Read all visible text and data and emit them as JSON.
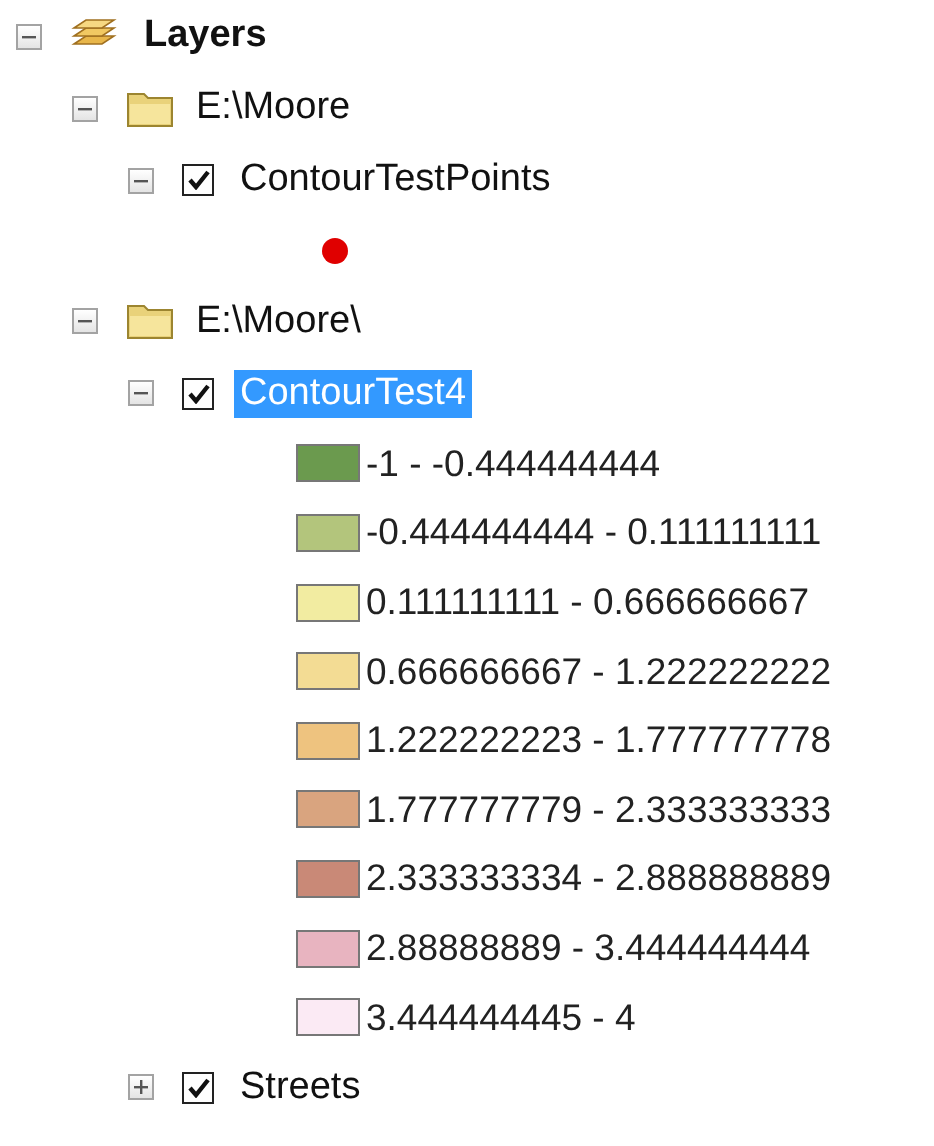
{
  "tree": {
    "label": "Layers",
    "kind": "root",
    "expanded": true,
    "children": [
      {
        "label": "E:\\Moore",
        "kind": "folder",
        "expanded": true,
        "children": [
          {
            "label": "ContourTestPoints",
            "kind": "layer",
            "expanded": true,
            "checked": true,
            "selected": false,
            "legend": [
              {
                "kind": "marker",
                "color": "#e00000"
              }
            ]
          }
        ]
      },
      {
        "label": "E:\\Moore\\",
        "kind": "folder",
        "expanded": true,
        "children": [
          {
            "label": "ContourTest4",
            "kind": "layer",
            "expanded": true,
            "checked": true,
            "selected": true,
            "legend": [
              {
                "kind": "swatch",
                "label": "-1 - -0.444444444",
                "color": "#6b9a4e"
              },
              {
                "kind": "swatch",
                "label": "-0.444444444 - 0.111111111",
                "color": "#b3c57c"
              },
              {
                "kind": "swatch",
                "label": "0.111111111 - 0.666666667",
                "color": "#f2eca1"
              },
              {
                "kind": "swatch",
                "label": "0.666666667 - 1.222222222",
                "color": "#f3dc94"
              },
              {
                "kind": "swatch",
                "label": "1.222222223 - 1.777777778",
                "color": "#eec37f"
              },
              {
                "kind": "swatch",
                "label": "1.777777779 - 2.333333333",
                "color": "#d9a47f"
              },
              {
                "kind": "swatch",
                "label": "2.333333334 - 2.888888889",
                "color": "#c98977"
              },
              {
                "kind": "swatch",
                "label": "2.88888889 - 3.444444444",
                "color": "#e8b4c0"
              },
              {
                "kind": "swatch",
                "label": "3.444444445 - 4",
                "color": "#fbeaf4"
              }
            ]
          },
          {
            "label": "Streets",
            "kind": "layer",
            "expanded": false,
            "checked": true,
            "selected": false
          }
        ]
      }
    ]
  }
}
